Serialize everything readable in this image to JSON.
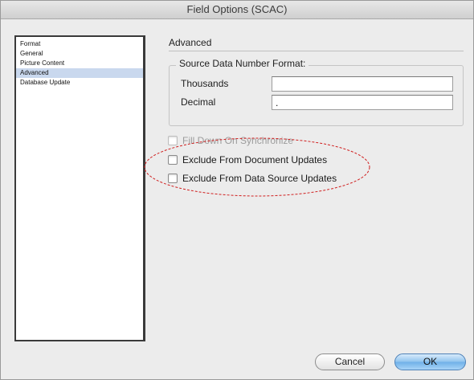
{
  "window": {
    "title": "Field Options (SCAC)"
  },
  "sidebar": {
    "items": [
      {
        "label": "Format",
        "selected": false
      },
      {
        "label": "General",
        "selected": false
      },
      {
        "label": "Picture Content",
        "selected": false
      },
      {
        "label": "Advanced",
        "selected": true
      },
      {
        "label": "Database Update",
        "selected": false
      }
    ]
  },
  "panel": {
    "title": "Advanced",
    "number_format": {
      "legend": "Source Data Number Format:",
      "thousands_label": "Thousands",
      "thousands_value": "",
      "decimal_label": "Decimal",
      "decimal_value": "."
    },
    "options": [
      {
        "label": "Fill Down On Synchronize",
        "checked": false,
        "enabled": false
      },
      {
        "label": "Exclude From Document Updates",
        "checked": false,
        "enabled": true
      },
      {
        "label": "Exclude From Data Source Updates",
        "checked": false,
        "enabled": true
      }
    ]
  },
  "buttons": {
    "cancel": "Cancel",
    "ok": "OK"
  },
  "colors": {
    "selection": "#c9d8ee",
    "annotation": "#d02020",
    "default_button": "#6fb0e8"
  }
}
